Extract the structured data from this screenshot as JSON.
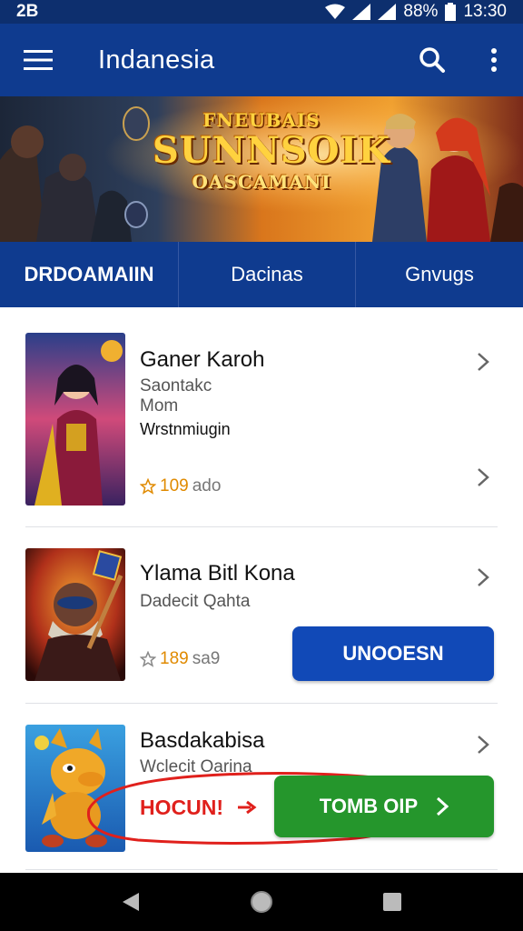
{
  "status_bar": {
    "time_left": "2B",
    "battery": "88%",
    "time": "13:30"
  },
  "app_bar": {
    "title": "Indanesia",
    "menu_icon": "hamburger-menu-icon",
    "search_icon": "search-icon",
    "more_icon": "more-vert-icon"
  },
  "banner": {
    "line1": "FNEUBAIS",
    "line2": "SUNNSOIK",
    "line3": "OASCAMANI"
  },
  "tabs": [
    {
      "label": "DRDOAMAIIN"
    },
    {
      "label": "Dacinas"
    },
    {
      "label": "Gnvugs"
    }
  ],
  "games": [
    {
      "name": "Ganer Karoh",
      "subtitle": "Saontakc",
      "subtitle2": "Mom",
      "meta": "Wrstnmiugin",
      "rating": "109",
      "rating_suffix": "ado"
    },
    {
      "name": "Ylama Bitl Kona",
      "subtitle": "Dadecit Qahta",
      "rating": "189",
      "rating_suffix": "sa9",
      "action_label": "UNOOESN"
    },
    {
      "name": "Basdakabisa",
      "subtitle": "Wclecit Oarina",
      "promo_label": "HOCUN!",
      "action_label": "TOMB OIP"
    }
  ],
  "colors": {
    "primary": "#0f3b8f",
    "status_bar": "#0d2f6e",
    "blue_button": "#1149b7",
    "green_button": "#25962c",
    "promo_red": "#e0201c",
    "rating_orange": "#e08a00"
  },
  "nav_icons": [
    "back-icon",
    "home-icon",
    "recents-icon"
  ]
}
